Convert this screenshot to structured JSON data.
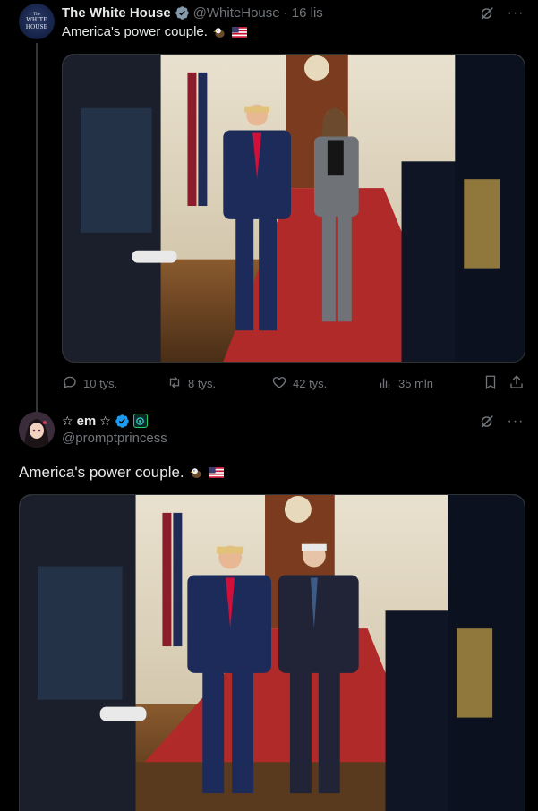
{
  "tweet1": {
    "avatar_text_top": "The",
    "avatar_text_main": "WHITE HOUSE",
    "display_name": "The White House",
    "handle": "@WhiteHouse",
    "time": "· 16 lis",
    "text": "America's power couple.",
    "emojis": [
      "eagle-emoji",
      "us-flag-emoji"
    ],
    "stats": {
      "replies": "10 tys.",
      "reposts": "8 tys.",
      "likes": "42 tys.",
      "views": "35 mln"
    }
  },
  "tweet2": {
    "display_name": "em",
    "handle": "@promptprincess",
    "text": "America's power couple.",
    "emojis": [
      "eagle-emoji",
      "us-flag-emoji"
    ]
  },
  "colors": {
    "background": "#000000",
    "text": "#e7e9ea",
    "muted": "#71767b",
    "verified_gray": "#829aab",
    "verified_blue": "#1d9bf0",
    "carpet": "#b02a2a"
  },
  "icons": [
    "grok-icon",
    "more-icon",
    "reply-icon",
    "repost-icon",
    "like-icon",
    "views-icon",
    "bookmark-icon",
    "share-icon",
    "verified-badge-icon"
  ]
}
